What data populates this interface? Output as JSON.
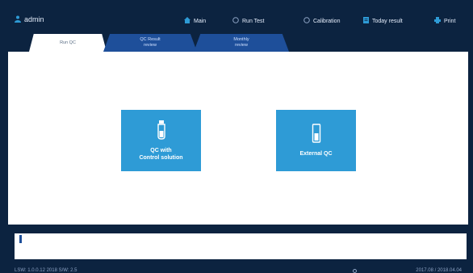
{
  "topbar": {
    "user": "admin",
    "nav": [
      {
        "label": "Main",
        "icon": "home-icon"
      },
      {
        "label": "Run Test",
        "icon": "run-test-icon"
      },
      {
        "label": "Calibration",
        "icon": "calibration-icon"
      },
      {
        "label": "Today result",
        "icon": "today-result-icon"
      },
      {
        "label": "Print",
        "icon": "print-icon"
      }
    ]
  },
  "tabs": [
    {
      "line1": "Run QC",
      "line2": ""
    },
    {
      "line1": "QC Result",
      "line2": "review"
    },
    {
      "line1": "Monthly",
      "line2": "review"
    }
  ],
  "main": {
    "control_btn": {
      "line1": "QC with",
      "line2": "Control solution",
      "icon": "control-solution-vial-icon"
    },
    "external_btn": {
      "line1": "External QC",
      "icon": "external-qc-cartridge-icon"
    }
  },
  "status": {
    "left": "LSW: 1.0.0.12  2018  S/W: 2.5",
    "right": "2017.08 / 2018.04.04"
  },
  "colors": {
    "frame": "#0c2340",
    "tab_inactive": "#1e4f9a",
    "button": "#2e9bd6"
  }
}
